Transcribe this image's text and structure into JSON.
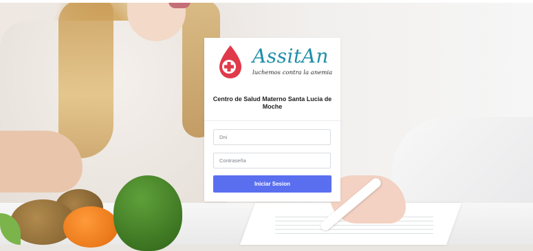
{
  "brand": {
    "name": "AssitAn",
    "tagline": "luchemos contra la anemia",
    "logo_icon": "blood-drop-medical-cross-icon",
    "colors": {
      "brand_text": "#1e8fa8",
      "drop": "#e03a4a",
      "button": "#5a6ef0"
    }
  },
  "login": {
    "center_name": "Centro de Salud Materno Santa Lucia de Moche",
    "dni_placeholder": "Dni",
    "password_placeholder": "Contraseña",
    "submit_label": "Iniciar Sesion"
  }
}
